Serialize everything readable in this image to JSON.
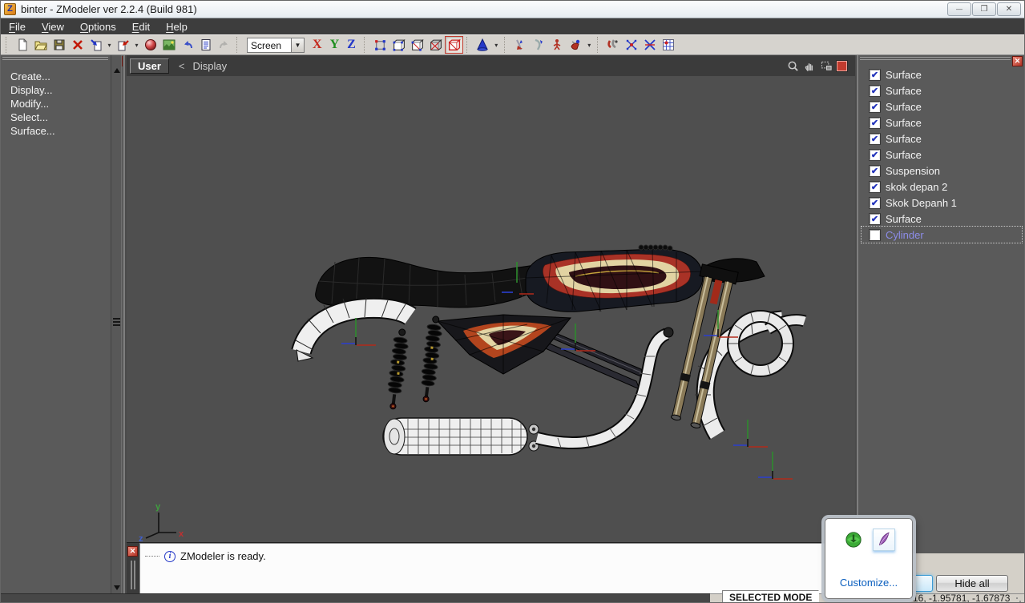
{
  "window": {
    "title": "binter - ZModeler ver 2.2.4 (Build 981)"
  },
  "menubar": {
    "items": [
      "File",
      "View",
      "Options",
      "Edit",
      "Help"
    ]
  },
  "toolbar": {
    "view_selector_value": "Screen",
    "axis_toggles": [
      "X",
      "Y",
      "Z"
    ],
    "icons": [
      "new-file",
      "open-file",
      "save-file",
      "delete",
      "import",
      "import-dropdown",
      "export",
      "export-dropdown",
      "material-sphere",
      "texture-browser",
      "undo",
      "notes",
      "redo",
      "view-selector",
      "axis-x",
      "axis-y",
      "axis-z",
      "vertices-mode",
      "edges-mode",
      "polygons-mode",
      "objects-mode",
      "surfaces-mode",
      "create-primitive-cone",
      "primitive-dropdown",
      "detach-tool",
      "bend-tool",
      "skeleton-tool",
      "skin-tool",
      "skin-dropdown",
      "magnet-tool",
      "weld-vertices-tool",
      "break-weld-tool",
      "snap-grid-tool"
    ]
  },
  "left_panel": {
    "items": [
      "Create...",
      "Display...",
      "Modify...",
      "Select...",
      "Surface..."
    ]
  },
  "viewport": {
    "tab_label": "User",
    "breadcrumb_arrow": "<",
    "mode_label": "Display"
  },
  "right_panel": {
    "items": [
      {
        "label": "Surface",
        "checked": true
      },
      {
        "label": "Surface",
        "checked": true
      },
      {
        "label": "Surface",
        "checked": true
      },
      {
        "label": "Surface",
        "checked": true
      },
      {
        "label": "Surface",
        "checked": true
      },
      {
        "label": "Surface",
        "checked": true
      },
      {
        "label": "Suspension",
        "checked": true
      },
      {
        "label": "skok depan 2",
        "checked": true
      },
      {
        "label": "Skok Depanh 1",
        "checked": true
      },
      {
        "label": "Surface",
        "checked": true
      },
      {
        "label": "Cylinder",
        "checked": false,
        "selected": true
      }
    ]
  },
  "status": {
    "message": "ZModeler is ready."
  },
  "tray_popup": {
    "customize_label": "Customize...",
    "icons": [
      "download-manager-icon",
      "feather-pen-icon"
    ]
  },
  "bottom_bar": {
    "hide_all_label": "Hide all",
    "selected_mode_label": "SELECTED MODE",
    "coordinates": "16, -1.95781, -1.67873"
  },
  "colors": {
    "accent_red": "#C23B2E",
    "check_blue": "#2233BB",
    "link_blue": "#0B5FBF",
    "selected_item_text": "#8C8CE8",
    "viewport_bg": "#4F4F4F",
    "panel_bg": "#5A5A5A",
    "menubar_bg": "#3D3D3D",
    "toolbar_bg": "#D6D3CE"
  }
}
